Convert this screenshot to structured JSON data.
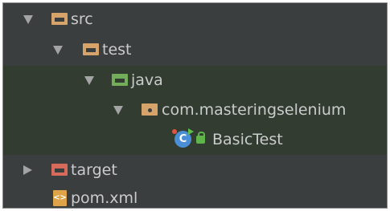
{
  "project_tree": {
    "src": {
      "label": "src"
    },
    "test": {
      "label": "test"
    },
    "java": {
      "label": "java"
    },
    "package": {
      "label": "com.masteringselenium"
    },
    "class": {
      "label": "BasicTest",
      "icon_glyph": "C"
    },
    "target": {
      "label": "target"
    },
    "pom": {
      "label": "pom.xml",
      "icon_glyph": "<>"
    }
  },
  "colors": {
    "background": "#3b3e3f",
    "test_source_background": "#333c30",
    "text": "#c9cbcd",
    "source_folder": "#d6a36a",
    "test_folder": "#73ad5a",
    "excluded_folder": "#d86a5c"
  },
  "icons": {
    "expanded": "chevron-down-icon",
    "collapsed": "chevron-right-icon",
    "folder": "folder-icon",
    "package": "package-icon",
    "class": "java-class-icon",
    "lock": "lock-icon",
    "xml": "xml-file-icon"
  }
}
